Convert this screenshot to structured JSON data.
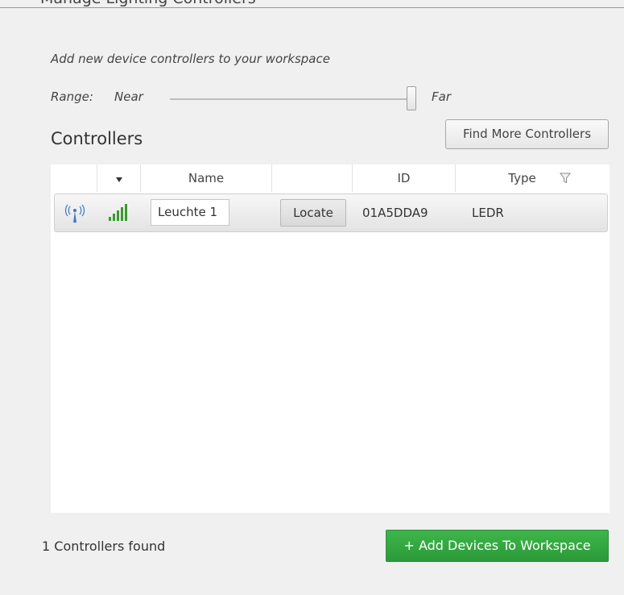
{
  "header": {
    "clipped_title": "Manage Lighting Controllers"
  },
  "intro_text": "Add new device controllers to your workspace",
  "range": {
    "label": "Range:",
    "min_label": "Near",
    "max_label": "Far",
    "value_fraction": 1.0
  },
  "controllers": {
    "heading": "Controllers",
    "find_more_label": "Find More Controllers"
  },
  "table": {
    "columns": [
      "",
      "",
      "Name",
      "",
      "ID",
      "Type"
    ],
    "sorted_column_index": 1,
    "rows": [
      {
        "name": "Leuchte 1",
        "action_label": "Locate",
        "id": "01A5DDA9",
        "type": "LEDR",
        "signal_bars": 4
      }
    ]
  },
  "footer": {
    "found_text": "1 Controllers found",
    "add_button_label": "+ Add Devices To Workspace"
  },
  "colors": {
    "accent_green": "#2fa43c",
    "signal_green": "#3a9b2e",
    "wireless_blue": "#3a78c8",
    "panel_background": "#ffffff",
    "window_background": "#f0f0f0"
  },
  "icons": {
    "wireless": "wireless-broadcast-icon",
    "signal": "signal-strength-icon",
    "filter": "filter-funnel-icon",
    "sort": "sort-descending-arrow-icon"
  }
}
